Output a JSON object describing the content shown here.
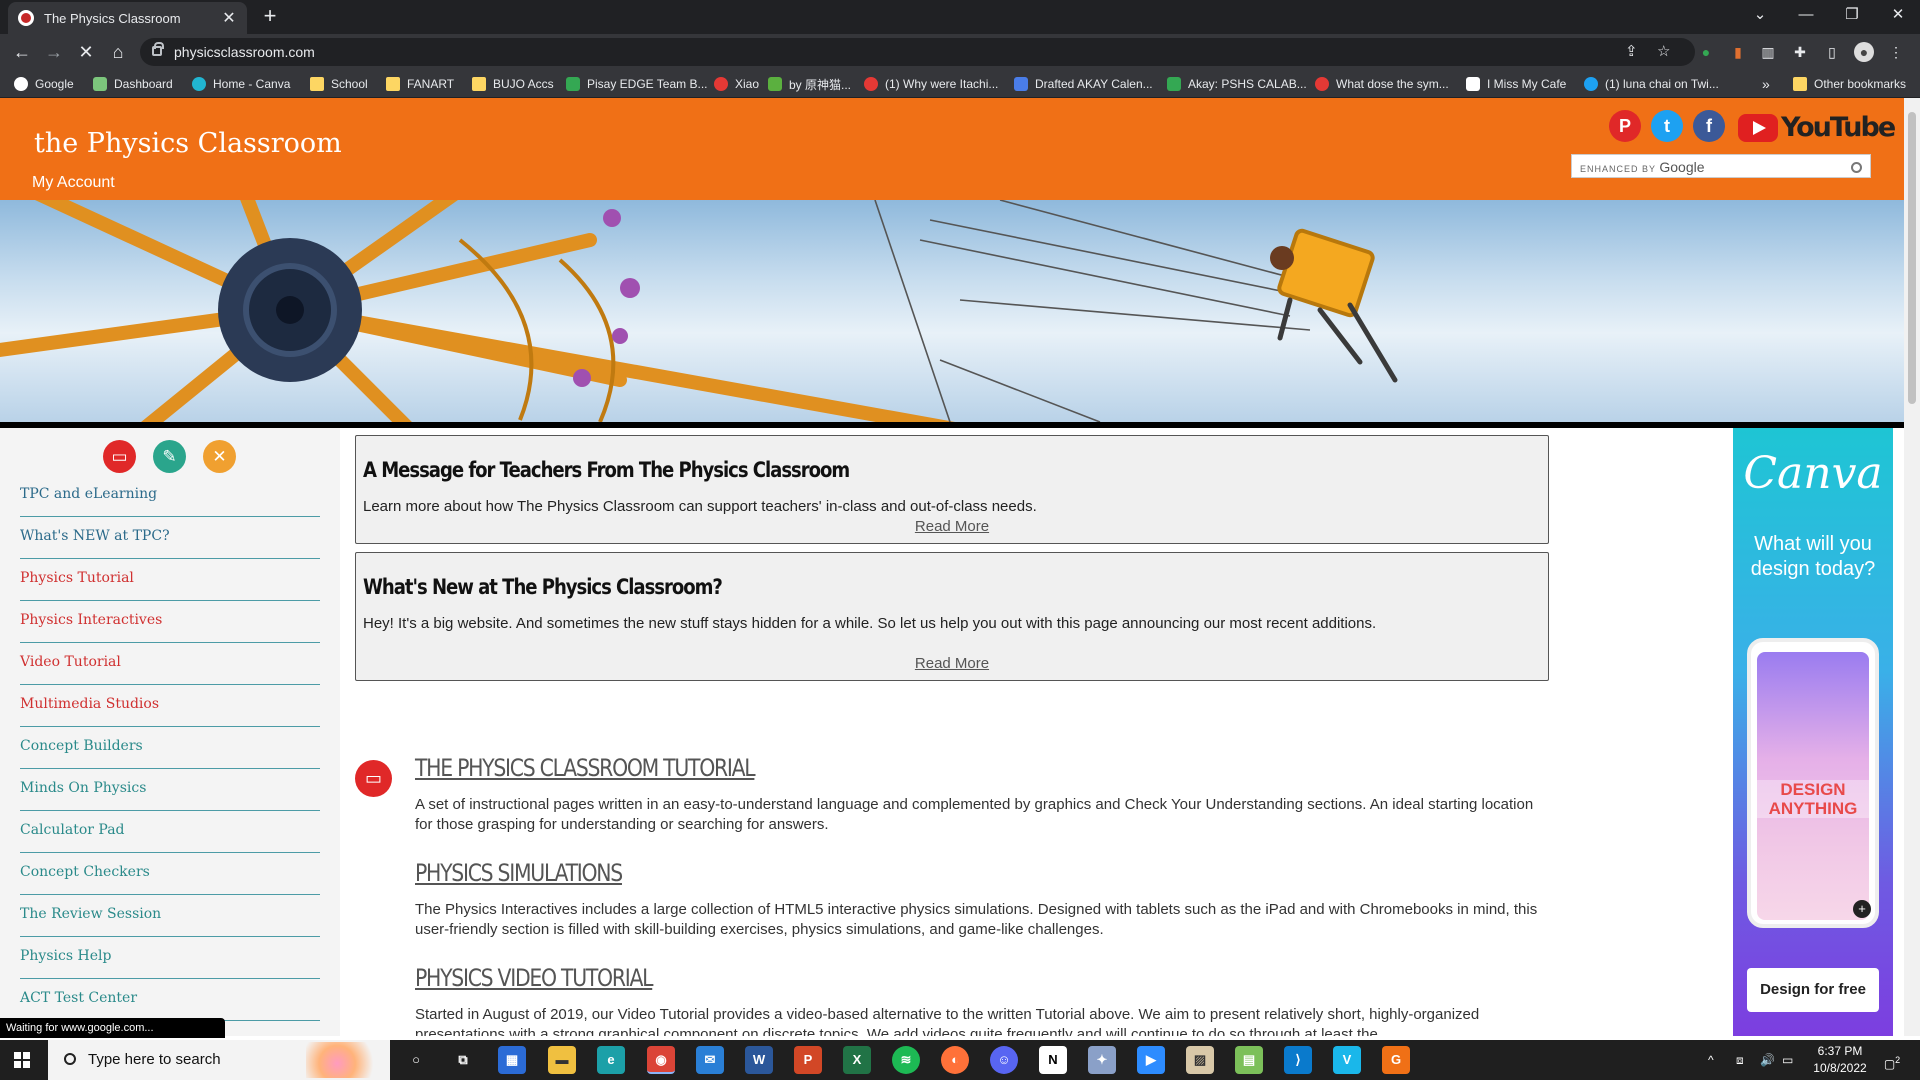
{
  "browser": {
    "tab_title": "The Physics Classroom",
    "tab_close": "✕",
    "new_tab": "+",
    "url": "physicsclassroom.com",
    "window_controls": [
      "⌄",
      "—",
      "❐",
      "✕"
    ],
    "bookmarks": [
      {
        "label": "Google",
        "icon": "google-icon",
        "color": "#ffffff"
      },
      {
        "label": "Dashboard",
        "icon": "dashboard-icon",
        "color": "#7cc67c"
      },
      {
        "label": "Home - Canva",
        "icon": "canva-icon",
        "color": "#21b5d1"
      },
      {
        "label": "School",
        "icon": "folder-icon",
        "color": "#fdd663"
      },
      {
        "label": "FANART",
        "icon": "folder-icon",
        "color": "#fdd663"
      },
      {
        "label": "BUJO Accs",
        "icon": "folder-icon",
        "color": "#fdd663"
      },
      {
        "label": "Pisay EDGE Team B...",
        "icon": "drive-icon",
        "color": "#34a853"
      },
      {
        "label": "Xiao",
        "icon": "red-circle-icon",
        "color": "#e53935"
      },
      {
        "label": "by 原神猫...",
        "icon": "leaf-icon",
        "color": "#5bb03f"
      },
      {
        "label": "(1) Why were Itachi...",
        "icon": "c-icon",
        "color": "#e53935"
      },
      {
        "label": "Drafted AKAY Calen...",
        "icon": "docs-icon",
        "color": "#4a7de8"
      },
      {
        "label": "Akay: PSHS CALAB...",
        "icon": "drive-icon",
        "color": "#34a853"
      },
      {
        "label": "What dose the sym...",
        "icon": "red-circle-icon",
        "color": "#e53935"
      },
      {
        "label": "I Miss My Cafe",
        "icon": "image-icon",
        "color": "#ffffff"
      },
      {
        "label": "(1) luna chai on Twi...",
        "icon": "twitter-icon",
        "color": "#1da1f2"
      }
    ],
    "more_bookmarks": "»",
    "other_bookmarks": "Other bookmarks"
  },
  "site": {
    "title": "the Physics Classroom",
    "account": "My Account",
    "search_label": "ENHANCED BY",
    "search_brand": "Google",
    "youtube": "YouTube",
    "social": [
      {
        "name": "pinterest",
        "glyph": "P",
        "color": "#e02828"
      },
      {
        "name": "twitter",
        "glyph": "t",
        "color": "#1da1f2"
      },
      {
        "name": "facebook",
        "glyph": "f",
        "color": "#3b5998"
      }
    ]
  },
  "sidebar": {
    "category_icons": [
      {
        "name": "tutorial-icon",
        "glyph": "▭",
        "color": "#e02828"
      },
      {
        "name": "worksheet-icon",
        "glyph": "✎",
        "color": "#2aa58c"
      },
      {
        "name": "tools-icon",
        "glyph": "✕",
        "color": "#f0a030"
      }
    ],
    "links": [
      {
        "label": "TPC and eLearning",
        "color": "#2b6a8a"
      },
      {
        "label": "What's NEW at TPC?",
        "color": "#2b6a8a"
      },
      {
        "label": "Physics Tutorial",
        "color": "#d03030"
      },
      {
        "label": "Physics Interactives",
        "color": "#d03030"
      },
      {
        "label": "Video Tutorial",
        "color": "#d03030"
      },
      {
        "label": "Multimedia Studios",
        "color": "#d03030"
      },
      {
        "label": "Concept Builders",
        "color": "#2a8a8a"
      },
      {
        "label": "Minds On Physics",
        "color": "#2a8a8a"
      },
      {
        "label": "Calculator Pad",
        "color": "#2a8a8a"
      },
      {
        "label": "Concept Checkers",
        "color": "#2a8a8a"
      },
      {
        "label": "The Review Session",
        "color": "#2a8a8a"
      },
      {
        "label": "Physics Help",
        "color": "#2a8a8a"
      },
      {
        "label": "ACT Test Center",
        "color": "#2a8a8a"
      }
    ]
  },
  "messages": [
    {
      "title": "A Message for Teachers From The Physics Classroom",
      "body": "Learn more about how The Physics Classroom can support teachers' in-class and out-of-class needs.",
      "link": "Read More"
    },
    {
      "title": "What's New at The Physics Classroom?",
      "body": "Hey! It's a big website. And sometimes the new stuff stays hidden for a while. So let us help you out with this page announcing our most recent additions.",
      "link": "Read More"
    }
  ],
  "sections": [
    {
      "title": "THE PHYSICS CLASSROOM TUTORIAL",
      "body": "A set of instructional pages written in an easy-to-understand language and complemented by graphics and Check Your Understanding sections. An ideal starting location for those grasping for understanding or searching for answers."
    },
    {
      "title": "PHYSICS SIMULATIONS",
      "body": "The Physics Interactives includes a large collection of HTML5 interactive physics simulations. Designed with tablets such as the iPad and with Chromebooks in mind, this user-friendly section is filled with skill-building exercises, physics simulations, and game-like challenges."
    },
    {
      "title": "PHYSICS VIDEO TUTORIAL",
      "body": "Started in August of 2019, our Video Tutorial provides a video-based alternative to the written Tutorial above. We aim to present relatively short, highly-organized presentations with a strong graphical component on discrete topics. We add videos quite frequently and will continue to do so through at least the"
    }
  ],
  "ad": {
    "logo": "Canva",
    "tagline": "What will you design today?",
    "phone_text": "DESIGN ANYTHING",
    "phone_plus": "+",
    "cta": "Design for free"
  },
  "status_bar": "Waiting for www.google.com...",
  "taskbar": {
    "search_placeholder": "Type here to search",
    "apps": [
      {
        "name": "cortana-icon",
        "glyph": "○",
        "color": "#1f1f1f"
      },
      {
        "name": "task-view-icon",
        "glyph": "⧉",
        "color": "#1f1f1f"
      },
      {
        "name": "store-icon",
        "glyph": "▦",
        "color": "#2b6bd6"
      },
      {
        "name": "file-explorer-icon",
        "glyph": "▬",
        "color": "#f0c040"
      },
      {
        "name": "edge-icon",
        "glyph": "e",
        "color": "#1ca0a8"
      },
      {
        "name": "chrome-icon",
        "glyph": "◉",
        "color": "#db4437"
      },
      {
        "name": "mail-icon",
        "glyph": "✉",
        "color": "#2a7fd6"
      },
      {
        "name": "word-icon",
        "glyph": "W",
        "color": "#2b579a"
      },
      {
        "name": "powerpoint-icon",
        "glyph": "P",
        "color": "#d24726"
      },
      {
        "name": "excel-icon",
        "glyph": "X",
        "color": "#217346"
      },
      {
        "name": "spotify-icon",
        "glyph": "≋",
        "color": "#1db954"
      },
      {
        "name": "firefox-icon",
        "glyph": "◐",
        "color": "#ff7139"
      },
      {
        "name": "discord-icon",
        "glyph": "☺",
        "color": "#5865f2"
      },
      {
        "name": "notion-icon",
        "glyph": "N",
        "color": "#ffffff"
      },
      {
        "name": "app-icon",
        "glyph": "✦",
        "color": "#8aa0c8"
      },
      {
        "name": "zoom-icon",
        "glyph": "▶",
        "color": "#2d8cff"
      },
      {
        "name": "paint-icon",
        "glyph": "▨",
        "color": "#d8c8a8"
      },
      {
        "name": "notepad-icon",
        "glyph": "▤",
        "color": "#7cc05a"
      },
      {
        "name": "vscode-icon",
        "glyph": "⟩",
        "color": "#0a7acc"
      },
      {
        "name": "vimeo-icon",
        "glyph": "V",
        "color": "#1ab7ea"
      },
      {
        "name": "app2-icon",
        "glyph": "G",
        "color": "#f07016"
      }
    ],
    "tray": "^",
    "time": "6:37 PM",
    "date": "10/8/2022",
    "notifications": "2"
  }
}
